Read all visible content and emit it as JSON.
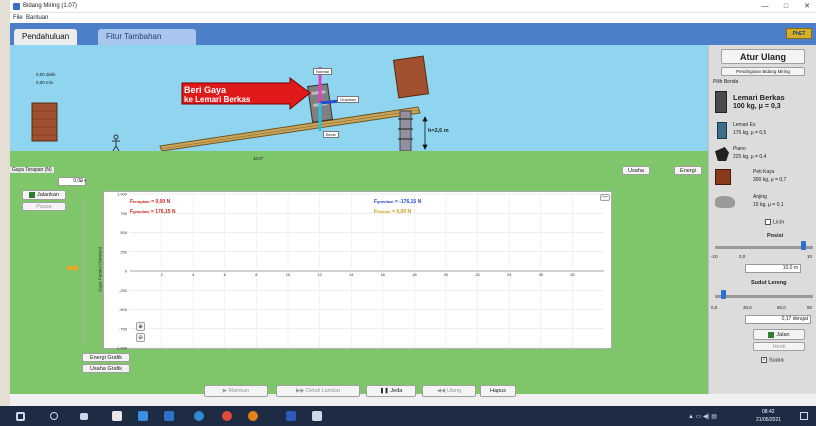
{
  "window": {
    "title": "Bidang Miring (1.07)"
  },
  "menu": {
    "file": "File",
    "help": "Bantuan"
  },
  "tabs": [
    {
      "label": "Pendahuluan"
    },
    {
      "label": "Fitur Tambahan"
    }
  ],
  "scene": {
    "stats": {
      "distance": "0,00 detik",
      "speed": "0,00 m/s"
    },
    "callout": {
      "line1": "Beri Gaya",
      "line2": "ke Lemari Berkas"
    },
    "vectors": {
      "top": "Normal",
      "right": "Gravitasi",
      "bottom": "Berat"
    },
    "height_label": "h=2,6 m",
    "angle_label": "10,0°",
    "force_panel_label": "Gaya Terapan (N)",
    "force_value": "0,00",
    "apply_button": "Jalankan",
    "pause_button": "Pause",
    "buttons": {
      "usaha": "Usaha",
      "energi": "Energi"
    }
  },
  "chart": {
    "y_ticks": [
      "1.000",
      "750",
      "500",
      "250",
      "0",
      "-250",
      "-500",
      "-750",
      "-1.000"
    ],
    "x_ticks": [
      "2",
      "4",
      "6",
      "8",
      "10",
      "12",
      "14",
      "16",
      "18",
      "20",
      "22",
      "24",
      "26",
      "28"
    ],
    "ylabel": "Gaya Paralel (Newton)",
    "legend_left": [
      {
        "main": "F",
        "sub": "terapkan",
        "value": "= 0,00 N",
        "color": "#d2261f"
      },
      {
        "main": "F",
        "sub": "gravitasi",
        "value": "= 176,15 N",
        "color": "#d2261f"
      }
    ],
    "legend_right": [
      {
        "main": "F",
        "sub": "gravitasi",
        "value": "= -176,15 N",
        "color": "#2a4bd0"
      },
      {
        "main": "F",
        "sub": "friction",
        "value": "= 0,00 N",
        "color": "#c9a016"
      }
    ],
    "side_buttons": [
      "Energi Grafik",
      "Usaha Grafik"
    ]
  },
  "bottom": {
    "controls": [
      "Mainkan",
      "Detail Lambat",
      "Jeda",
      "Ulang",
      "Hapus"
    ]
  },
  "right_panel": {
    "reset": "Atur Ulang",
    "reset_ramp": "Pendinginan Bidang Miring",
    "choose_object": "Pilih Benda",
    "objects": [
      {
        "name": "Lemari Berkas",
        "detail": "100 kg, μ = 0,3",
        "color": "#4a4a4a"
      },
      {
        "name": "Lemari Es",
        "detail": "175 kg, μ = 0,5",
        "color": "#3d6e8a"
      },
      {
        "name": "Piano",
        "detail": "225 kg, μ = 0,4",
        "color": "#222222"
      },
      {
        "name": "Peti Kayu",
        "detail": "300 kg, μ = 0,7",
        "color": "#8a3a1a"
      },
      {
        "name": "Anjing",
        "detail": "15 kg, μ = 0,1",
        "color": "#9a9a9a"
      }
    ],
    "ice_checkbox": "Licin",
    "position_label": "Posisi",
    "position_ticks": [
      "-10",
      "0,0",
      "10"
    ],
    "position_value": "10,0 m",
    "angle_label": "Sudut Lereng",
    "angle_ticks": [
      "0,0",
      "30,0",
      "60,0",
      "90"
    ],
    "angle_value": "0,17 derajat",
    "run_button": "Jalan",
    "pause_button": "Henti",
    "sound_checkbox": "Suara"
  },
  "taskbar": {
    "time": "08:42",
    "date": "21/05/2021"
  }
}
